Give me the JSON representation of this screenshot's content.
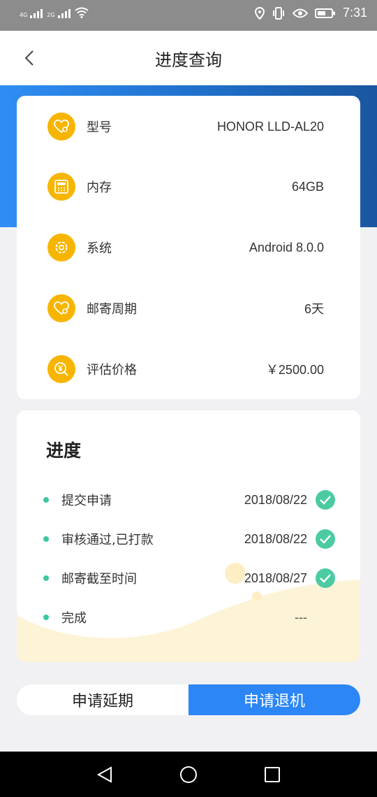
{
  "status_bar": {
    "net1": "4G",
    "net2": "2G",
    "time": "7:31"
  },
  "header": {
    "title": "进度查询"
  },
  "specs": [
    {
      "icon": "heart-gear-icon",
      "label": "型号",
      "value": "HONOR LLD-AL20"
    },
    {
      "icon": "calculator-icon",
      "label": "内存",
      "value": "64GB"
    },
    {
      "icon": "gear-icon",
      "label": "系统",
      "value": "Android 8.0.0"
    },
    {
      "icon": "heart-gear-icon",
      "label": "邮寄周期",
      "value": "6天"
    },
    {
      "icon": "yuan-search-icon",
      "label": "评估价格",
      "value": "￥2500.00"
    }
  ],
  "progress": {
    "title": "进度",
    "steps": [
      {
        "label": "提交申请",
        "date": "2018/08/22",
        "done": true
      },
      {
        "label": "审核通过,已打款",
        "date": "2018/08/22",
        "done": true
      },
      {
        "label": "邮寄截至时间",
        "date": "2018/08/27",
        "done": true
      },
      {
        "label": "完成",
        "date": "---",
        "done": false
      }
    ]
  },
  "actions": {
    "extend_label": "申请延期",
    "return_label": "申请退机"
  },
  "colors": {
    "accent_blue": "#2c86f5",
    "icon_yellow": "#f7b500",
    "check_green": "#4ccba3"
  }
}
